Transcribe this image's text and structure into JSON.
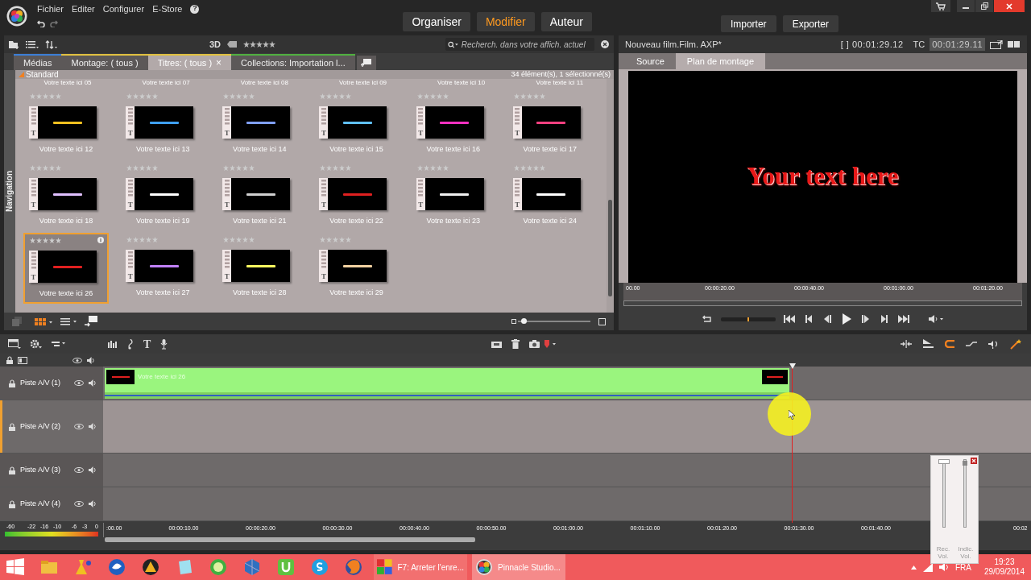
{
  "menu": [
    "Fichier",
    "Editer",
    "Configurer",
    "E-Store"
  ],
  "help": "?",
  "modes": [
    {
      "label": "Organiser",
      "selected": false
    },
    {
      "label": "Modifier",
      "selected": true
    },
    {
      "label": "Auteur",
      "selected": false
    }
  ],
  "actions": [
    "Importer",
    "Exporter"
  ],
  "library": {
    "toolbar_3d": "3D",
    "search": {
      "placeholder": "Recherch. dans votre affich. actuel"
    },
    "tabs": [
      {
        "label": "Médias",
        "selected": false,
        "closable": false
      },
      {
        "label": "Montage: ( tous )",
        "selected": false,
        "closable": false
      },
      {
        "label": "Titres: ( tous )",
        "selected": true,
        "closable": true
      },
      {
        "label": "Collections: Importation l...",
        "selected": false,
        "closable": false
      }
    ],
    "close_glyph": "×",
    "group": "Standard",
    "count": "34 élément(s), 1 sélectionné(s)",
    "side_label": "Navigation",
    "cut_labels": [
      "Votre texte ici 05",
      "Votre texte ici 07",
      "Votre texte ici 08",
      "Votre texte ici 09",
      "Votre texte ici 10",
      "Votre texte ici 11"
    ],
    "items": [
      {
        "label": "Votre texte ici 12",
        "mark": "T",
        "stars": 0,
        "selected": false,
        "color": "#f0c020"
      },
      {
        "label": "Votre texte ici 13",
        "mark": "T",
        "stars": 0,
        "selected": false,
        "color": "#3fa0f0"
      },
      {
        "label": "Votre texte ici 14",
        "mark": "T",
        "stars": 0,
        "selected": false,
        "color": "#80a0ff"
      },
      {
        "label": "Votre texte ici 15",
        "mark": "T",
        "stars": 0,
        "selected": false,
        "color": "#60c0ff"
      },
      {
        "label": "Votre texte ici 16",
        "mark": "T",
        "stars": 0,
        "selected": false,
        "color": "#ff30c0"
      },
      {
        "label": "Votre texte ici 17",
        "mark": "T",
        "stars": 0,
        "selected": false,
        "color": "#ff4080"
      },
      {
        "label": "Votre texte ici 18",
        "mark": "T",
        "stars": 0,
        "selected": false,
        "color": "#e0c0ff"
      },
      {
        "label": "Votre texte ici 19",
        "mark": "T",
        "stars": 0,
        "selected": false,
        "color": "#ffffff"
      },
      {
        "label": "Votre texte ici 21",
        "mark": "T",
        "stars": 0,
        "selected": false,
        "color": "#d0d0d0"
      },
      {
        "label": "Votre texte ici 22",
        "mark": "T",
        "stars": 0,
        "selected": false,
        "color": "#e02020"
      },
      {
        "label": "Votre texte ici 23",
        "mark": "T",
        "stars": 0,
        "selected": false,
        "color": "#f0f0f0"
      },
      {
        "label": "Votre texte ici 24",
        "mark": "T",
        "stars": 0,
        "selected": false,
        "color": "#ffffff"
      },
      {
        "label": "Votre texte ici 26",
        "mark": "T",
        "stars": 0,
        "selected": true,
        "color": "#e02020"
      },
      {
        "label": "Votre texte ici 27",
        "mark": "T",
        "stars": 0,
        "selected": false,
        "color": "#c080ff"
      },
      {
        "label": "Votre texte ici 28",
        "mark": "T",
        "stars": 0,
        "selected": false,
        "color": "#ffff60"
      },
      {
        "label": "Votre texte ici 29",
        "mark": "T",
        "stars": 0,
        "selected": false,
        "color": "#f0d0a0"
      }
    ],
    "zoom": {
      "level": 0.05
    }
  },
  "preview": {
    "title": "Nouveau film.Film. AXP*",
    "duration": "[ ] 00:01:29.12",
    "tc_label": "TC",
    "timecode": "00:01:29.11",
    "tabs": [
      {
        "label": "Source",
        "selected": false
      },
      {
        "label": "Plan de montage",
        "selected": true
      }
    ],
    "screen_text": "Your text here",
    "shuttle": {
      "level": 0.5
    },
    "ruler": [
      "00.00",
      "00:00:20.00",
      "00:00:40.00",
      "00:01:00.00",
      "00:01:20.00"
    ]
  },
  "timeline": {
    "text_tool": "T",
    "tracks": [
      {
        "name": "Piste A/V (1)",
        "selected": false
      },
      {
        "name": "Piste A/V (2)",
        "selected": true
      },
      {
        "name": "Piste A/V (3)",
        "selected": false
      },
      {
        "name": "Piste A/V (4)",
        "selected": false
      }
    ],
    "clip": {
      "label": "Votre texte ici 26"
    },
    "meter_scale": [
      "-60",
      "-22",
      "-16",
      "-10",
      "-6",
      "-3",
      "0"
    ],
    "ruler": [
      ":00.00",
      "00:00:10.00",
      "00:00:20.00",
      "00:00:30.00",
      "00:00:40.00",
      "00:00:50.00",
      "00:01:00.00",
      "00:01:10.00",
      "00:01:20.00",
      "00:01:30.00",
      "00:01:40.00",
      "00:02"
    ],
    "volume_popup": [
      "Rec. Vol.",
      "Indic. Vol."
    ],
    "sliders": {
      "record_volume": {
        "level": 1
      },
      "indicator_volume": {
        "level": 0.97
      }
    }
  },
  "taskbar": {
    "tasks": [
      {
        "label": "F7: Arreter l'enre...",
        "selected": false
      },
      {
        "label": "Pinnacle Studio...",
        "selected": true
      }
    ],
    "language": "FRA",
    "time": "19:23",
    "date": "29/09/2014"
  }
}
